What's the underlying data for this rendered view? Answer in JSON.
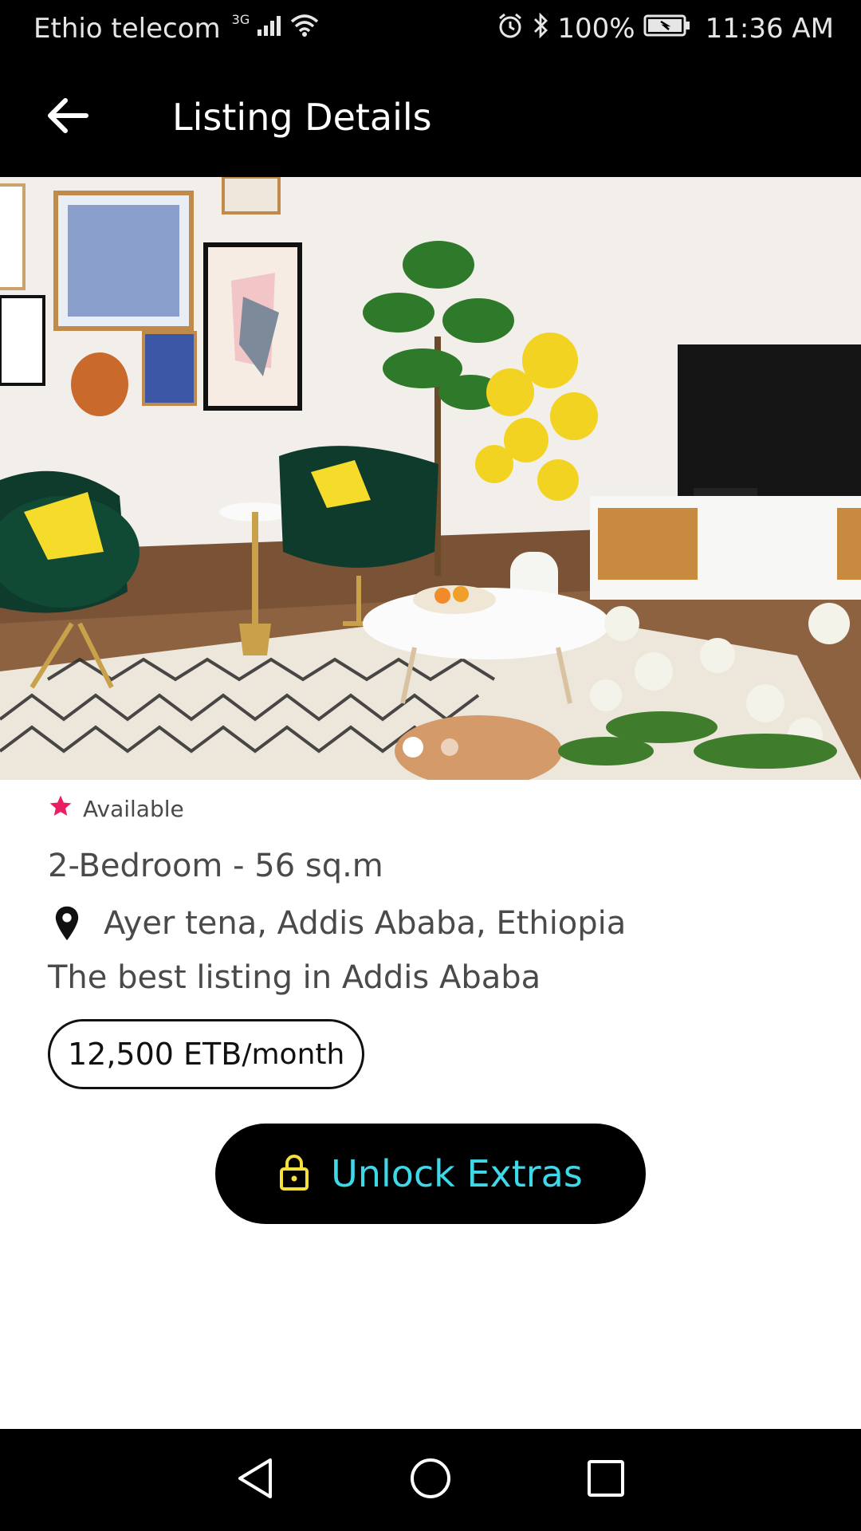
{
  "status_bar": {
    "carrier": "Ethio telecom",
    "network_type": "3G",
    "battery": "100%",
    "time": "11:36 AM",
    "icons": [
      "signal-icon",
      "wifi-icon",
      "alarm-icon",
      "bluetooth-icon",
      "battery-icon"
    ]
  },
  "app_bar": {
    "title": "Listing Details",
    "back_icon": "arrow-left-icon"
  },
  "gallery": {
    "image_description_icon": "living-room-photo",
    "page_count": 2,
    "active_page": 1
  },
  "listing": {
    "status": "Available",
    "status_icon": "star-icon",
    "status_color": "#e91e63",
    "title": "2-Bedroom - 56 sq.m",
    "location_icon": "map-pin-icon",
    "location": "Ayer tena, Addis Ababa, Ethiopia",
    "tagline": "The best listing in Addis Ababa",
    "price": "12,500 ETB",
    "price_period": "/month"
  },
  "actions": {
    "unlock_label": "Unlock Extras",
    "unlock_icon": "lock-icon",
    "unlock_text_color": "#3fd8e8",
    "unlock_icon_color": "#f5e13a"
  },
  "nav_bar": {
    "buttons": [
      "back-triangle-icon",
      "home-circle-icon",
      "recents-square-icon"
    ]
  }
}
